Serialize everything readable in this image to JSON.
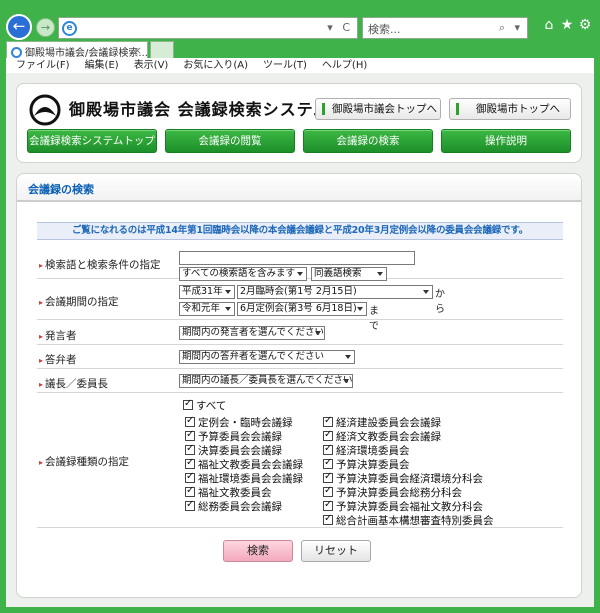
{
  "browser": {
    "address_value": "",
    "search_placeholder": "検索...",
    "tab_title": "御殿場市議会/会議録検索...",
    "menu": [
      "ファイル(F)",
      "編集(E)",
      "表示(V)",
      "お気に入り(A)",
      "ツール(T)",
      "ヘルプ(H)"
    ]
  },
  "header": {
    "title": "御殿場市議会 会議録検索システム",
    "link_council_top": "御殿場市議会トップへ",
    "link_city_top": "御殿場市トップへ"
  },
  "nav": [
    "会議録検索システムトップ",
    "会議録の閲覧",
    "会議録の検索",
    "操作説明"
  ],
  "panel": {
    "title": "会議録の検索",
    "notice": "ご覧になれるのは平成14年第1回臨時会以降の本会議会議録と平成20年3月定例会以降の委員会会議録です。",
    "rows": {
      "keyword": {
        "label": "検索語と検索条件の指定",
        "value": "",
        "mode": "すべての検索語を含みます",
        "synonym": "同義語検索"
      },
      "period": {
        "label": "会議期間の指定",
        "from_era": "平成31年",
        "from_session": "2月臨時会(第1号 2月15日)",
        "from_suffix": "から",
        "to_era": "令和元年",
        "to_session": "6月定例会(第3号 6月18日)",
        "to_suffix": "まで"
      },
      "speaker": {
        "label": "発言者",
        "value": "期間内の発言者を選んでください"
      },
      "responder": {
        "label": "答弁者",
        "value": "期間内の答弁者を選んでください"
      },
      "chair": {
        "label": "議長／委員長",
        "value": "期間内の議長／委員長を選んでください"
      },
      "types": {
        "label": "会議録種類の指定",
        "all": "すべて",
        "left": [
          "定例会・臨時会議録",
          "予算委員会会議録",
          "決算委員会会議録",
          "福祉文教委員会会議録",
          "福祉環境委員会会議録",
          "福祉文教委員会",
          "総務委員会会議録"
        ],
        "right": [
          "経済建設委員会会議録",
          "経済文教委員会会議録",
          "経済環境委員会",
          "予算決算委員会",
          "予算決算委員会経済環境分科会",
          "予算決算委員会総務分科会",
          "予算決算委員会福祉文教分科会",
          "総合計画基本構想審査特別委員会"
        ]
      }
    },
    "search_button": "検索",
    "reset_button": "リセット"
  },
  "colors": {
    "frame": "#3fb34a",
    "nav_button": "#1d8f2a",
    "title_blue": "#0a5fb4"
  }
}
